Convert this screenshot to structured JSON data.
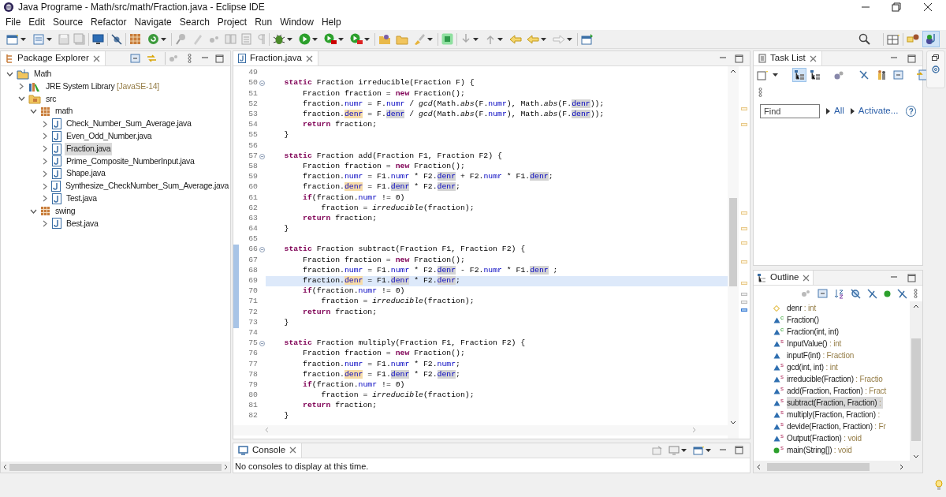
{
  "window": {
    "title": "Java Programe - Math/src/math/Fraction.java - Eclipse IDE"
  },
  "menu": [
    "File",
    "Edit",
    "Source",
    "Refactor",
    "Navigate",
    "Search",
    "Project",
    "Run",
    "Window",
    "Help"
  ],
  "package_explorer": {
    "title": "Package Explorer",
    "tree": [
      {
        "label": "Math",
        "kind": "project",
        "expanded": true,
        "selected": false,
        "children": [
          {
            "label": "JRE System Library",
            "suffix": "[JavaSE-14]",
            "kind": "library",
            "expanded": false,
            "selected": false
          },
          {
            "label": "src",
            "kind": "source-folder",
            "expanded": true,
            "selected": false,
            "children": [
              {
                "label": "math",
                "kind": "package",
                "expanded": true,
                "selected": false,
                "children": [
                  {
                    "label": "Check_Number_Sum_Average.java",
                    "kind": "java-file",
                    "expanded": false,
                    "selected": false
                  },
                  {
                    "label": "Even_Odd_Number.java",
                    "kind": "java-file",
                    "expanded": false,
                    "selected": false
                  },
                  {
                    "label": "Fraction.java",
                    "kind": "java-file",
                    "expanded": false,
                    "selected": true
                  },
                  {
                    "label": "Prime_Composite_NumberInput.java",
                    "kind": "java-file",
                    "expanded": false,
                    "selected": false
                  },
                  {
                    "label": "Shape.java",
                    "kind": "java-file",
                    "expanded": false,
                    "selected": false
                  },
                  {
                    "label": "Synthesize_CheckNumber_Sum_Average.java",
                    "kind": "java-file",
                    "expanded": false,
                    "selected": false
                  },
                  {
                    "label": "Test.java",
                    "kind": "java-file",
                    "expanded": false,
                    "selected": false
                  }
                ]
              },
              {
                "label": "swing",
                "kind": "package",
                "expanded": true,
                "selected": false,
                "children": [
                  {
                    "label": "Best.java",
                    "kind": "java-file",
                    "expanded": false,
                    "selected": false
                  }
                ]
              }
            ]
          }
        ]
      }
    ]
  },
  "editor": {
    "tab": "Fraction.java",
    "lines": [
      {
        "number": "49",
        "fold": false,
        "changed": false,
        "current": false
      },
      {
        "number": "50",
        "fold": true,
        "changed": false,
        "current": false,
        "tokens": [
          {
            "kind": "keyword",
            "text": "    static"
          },
          {
            "kind": "plain",
            "text": " Fraction irreducible(Fraction F) {"
          }
        ]
      },
      {
        "number": "51",
        "fold": false,
        "changed": false,
        "current": false,
        "tokens": [
          {
            "kind": "plain",
            "text": "        Fraction fraction = "
          },
          {
            "kind": "keyword",
            "text": "new"
          },
          {
            "kind": "plain",
            "text": " Fraction();"
          }
        ]
      },
      {
        "number": "52",
        "fold": false,
        "changed": false,
        "current": false,
        "tokens": [
          {
            "kind": "plain",
            "text": "        fraction."
          },
          {
            "kind": "field",
            "text": "numr"
          },
          {
            "kind": "plain",
            "text": " = F."
          },
          {
            "kind": "field",
            "text": "numr"
          },
          {
            "kind": "plain",
            "text": " / "
          },
          {
            "kind": "call",
            "text": "gcd"
          },
          {
            "kind": "plain",
            "text": "(Math."
          },
          {
            "kind": "call",
            "text": "abs"
          },
          {
            "kind": "plain",
            "text": "(F."
          },
          {
            "kind": "field",
            "text": "numr"
          },
          {
            "kind": "plain",
            "text": "), Math."
          },
          {
            "kind": "call",
            "text": "abs"
          },
          {
            "kind": "plain",
            "text": "(F."
          },
          {
            "kind": "field-read",
            "text": "denr"
          },
          {
            "kind": "plain",
            "text": "));"
          }
        ]
      },
      {
        "number": "53",
        "fold": false,
        "changed": false,
        "current": false,
        "tokens": [
          {
            "kind": "plain",
            "text": "        fraction."
          },
          {
            "kind": "field-write",
            "text": "denr"
          },
          {
            "kind": "plain",
            "text": " = F."
          },
          {
            "kind": "field-read",
            "text": "denr"
          },
          {
            "kind": "plain",
            "text": " / "
          },
          {
            "kind": "call",
            "text": "gcd"
          },
          {
            "kind": "plain",
            "text": "(Math."
          },
          {
            "kind": "call",
            "text": "abs"
          },
          {
            "kind": "plain",
            "text": "(F."
          },
          {
            "kind": "field",
            "text": "numr"
          },
          {
            "kind": "plain",
            "text": "), Math."
          },
          {
            "kind": "call",
            "text": "abs"
          },
          {
            "kind": "plain",
            "text": "(F."
          },
          {
            "kind": "field-read",
            "text": "denr"
          },
          {
            "kind": "plain",
            "text": "));"
          }
        ]
      },
      {
        "number": "54",
        "fold": false,
        "changed": false,
        "current": false,
        "tokens": [
          {
            "kind": "keyword",
            "text": "        return"
          },
          {
            "kind": "plain",
            "text": " fraction;"
          }
        ]
      },
      {
        "number": "55",
        "fold": false,
        "changed": false,
        "current": false,
        "tokens": [
          {
            "kind": "plain",
            "text": "    }"
          }
        ]
      },
      {
        "number": "56",
        "fold": false,
        "changed": false,
        "current": false
      },
      {
        "number": "57",
        "fold": true,
        "changed": false,
        "current": false,
        "tokens": [
          {
            "kind": "keyword",
            "text": "    static"
          },
          {
            "kind": "plain",
            "text": " Fraction add(Fraction F1, Fraction F2) {"
          }
        ]
      },
      {
        "number": "58",
        "fold": false,
        "changed": false,
        "current": false,
        "tokens": [
          {
            "kind": "plain",
            "text": "        Fraction fraction = "
          },
          {
            "kind": "keyword",
            "text": "new"
          },
          {
            "kind": "plain",
            "text": " Fraction();"
          }
        ]
      },
      {
        "number": "59",
        "fold": false,
        "changed": false,
        "current": false,
        "tokens": [
          {
            "kind": "plain",
            "text": "        fraction."
          },
          {
            "kind": "field",
            "text": "numr"
          },
          {
            "kind": "plain",
            "text": " = F1."
          },
          {
            "kind": "field",
            "text": "numr"
          },
          {
            "kind": "plain",
            "text": " * F2."
          },
          {
            "kind": "field-read",
            "text": "denr"
          },
          {
            "kind": "plain",
            "text": " + F2."
          },
          {
            "kind": "field",
            "text": "numr"
          },
          {
            "kind": "plain",
            "text": " * F1."
          },
          {
            "kind": "field-read",
            "text": "denr"
          },
          {
            "kind": "plain",
            "text": ";"
          }
        ]
      },
      {
        "number": "60",
        "fold": false,
        "changed": false,
        "current": false,
        "tokens": [
          {
            "kind": "plain",
            "text": "        fraction."
          },
          {
            "kind": "field-write",
            "text": "denr"
          },
          {
            "kind": "plain",
            "text": " = F1."
          },
          {
            "kind": "field-read",
            "text": "denr"
          },
          {
            "kind": "plain",
            "text": " * F2."
          },
          {
            "kind": "field-read",
            "text": "denr"
          },
          {
            "kind": "plain",
            "text": ";"
          }
        ]
      },
      {
        "number": "61",
        "fold": false,
        "changed": false,
        "current": false,
        "tokens": [
          {
            "kind": "keyword",
            "text": "        if"
          },
          {
            "kind": "plain",
            "text": "(fraction."
          },
          {
            "kind": "field",
            "text": "numr"
          },
          {
            "kind": "plain",
            "text": " != 0)"
          }
        ]
      },
      {
        "number": "62",
        "fold": false,
        "changed": false,
        "current": false,
        "tokens": [
          {
            "kind": "plain",
            "text": "            fraction = "
          },
          {
            "kind": "call",
            "text": "irreducible"
          },
          {
            "kind": "plain",
            "text": "(fraction);"
          }
        ]
      },
      {
        "number": "63",
        "fold": false,
        "changed": false,
        "current": false,
        "tokens": [
          {
            "kind": "keyword",
            "text": "        return"
          },
          {
            "kind": "plain",
            "text": " fraction;"
          }
        ]
      },
      {
        "number": "64",
        "fold": false,
        "changed": false,
        "current": false,
        "tokens": [
          {
            "kind": "plain",
            "text": "    }"
          }
        ]
      },
      {
        "number": "65",
        "fold": false,
        "changed": false,
        "current": false
      },
      {
        "number": "66",
        "fold": true,
        "changed": true,
        "current": false,
        "tokens": [
          {
            "kind": "keyword",
            "text": "    static"
          },
          {
            "kind": "plain",
            "text": " Fraction subtract(Fraction F1, Fraction F2) {"
          }
        ]
      },
      {
        "number": "67",
        "fold": false,
        "changed": true,
        "current": false,
        "tokens": [
          {
            "kind": "plain",
            "text": "        Fraction fraction = "
          },
          {
            "kind": "keyword",
            "text": "new"
          },
          {
            "kind": "plain",
            "text": " Fraction();"
          }
        ]
      },
      {
        "number": "68",
        "fold": false,
        "changed": true,
        "current": false,
        "tokens": [
          {
            "kind": "plain",
            "text": "        fraction."
          },
          {
            "kind": "field",
            "text": "numr"
          },
          {
            "kind": "plain",
            "text": " = F1."
          },
          {
            "kind": "field",
            "text": "numr"
          },
          {
            "kind": "plain",
            "text": " * F2."
          },
          {
            "kind": "field-read",
            "text": "denr"
          },
          {
            "kind": "plain",
            "text": " - F2."
          },
          {
            "kind": "field",
            "text": "numr"
          },
          {
            "kind": "plain",
            "text": " * F1."
          },
          {
            "kind": "field-read",
            "text": "denr"
          },
          {
            "kind": "plain",
            "text": " ;"
          }
        ]
      },
      {
        "number": "69",
        "fold": false,
        "changed": true,
        "current": true,
        "tokens": [
          {
            "kind": "plain",
            "text": "        fraction."
          },
          {
            "kind": "field-write",
            "text": "denr"
          },
          {
            "kind": "plain",
            "text": " = F1."
          },
          {
            "kind": "field-read",
            "text": "denr"
          },
          {
            "kind": "plain",
            "text": " * F2."
          },
          {
            "kind": "field-read",
            "text": "denr"
          },
          {
            "kind": "plain",
            "text": ";"
          }
        ]
      },
      {
        "number": "70",
        "fold": false,
        "changed": true,
        "current": false,
        "tokens": [
          {
            "kind": "keyword",
            "text": "        if"
          },
          {
            "kind": "plain",
            "text": "(fraction."
          },
          {
            "kind": "field",
            "text": "numr"
          },
          {
            "kind": "plain",
            "text": " != 0)"
          }
        ]
      },
      {
        "number": "71",
        "fold": false,
        "changed": true,
        "current": false,
        "tokens": [
          {
            "kind": "plain",
            "text": "            fraction = "
          },
          {
            "kind": "call",
            "text": "irreducible"
          },
          {
            "kind": "plain",
            "text": "(fraction);"
          }
        ]
      },
      {
        "number": "72",
        "fold": false,
        "changed": true,
        "current": false,
        "tokens": [
          {
            "kind": "keyword",
            "text": "        return"
          },
          {
            "kind": "plain",
            "text": " fraction;"
          }
        ]
      },
      {
        "number": "73",
        "fold": false,
        "changed": true,
        "current": false,
        "tokens": [
          {
            "kind": "plain",
            "text": "    }"
          }
        ]
      },
      {
        "number": "74",
        "fold": false,
        "changed": false,
        "current": false
      },
      {
        "number": "75",
        "fold": true,
        "changed": false,
        "current": false,
        "tokens": [
          {
            "kind": "keyword",
            "text": "    static"
          },
          {
            "kind": "plain",
            "text": " Fraction multiply(Fraction F1, Fraction F2) {"
          }
        ]
      },
      {
        "number": "76",
        "fold": false,
        "changed": false,
        "current": false,
        "tokens": [
          {
            "kind": "plain",
            "text": "        Fraction fraction = "
          },
          {
            "kind": "keyword",
            "text": "new"
          },
          {
            "kind": "plain",
            "text": " Fraction();"
          }
        ]
      },
      {
        "number": "77",
        "fold": false,
        "changed": false,
        "current": false,
        "tokens": [
          {
            "kind": "plain",
            "text": "        fraction."
          },
          {
            "kind": "field",
            "text": "numr"
          },
          {
            "kind": "plain",
            "text": " = F1."
          },
          {
            "kind": "field",
            "text": "numr"
          },
          {
            "kind": "plain",
            "text": " * F2."
          },
          {
            "kind": "field",
            "text": "numr"
          },
          {
            "kind": "plain",
            "text": ";"
          }
        ]
      },
      {
        "number": "78",
        "fold": false,
        "changed": false,
        "current": false,
        "tokens": [
          {
            "kind": "plain",
            "text": "        fraction."
          },
          {
            "kind": "field-write",
            "text": "denr"
          },
          {
            "kind": "plain",
            "text": " = F1."
          },
          {
            "kind": "field-read",
            "text": "denr"
          },
          {
            "kind": "plain",
            "text": " * F2."
          },
          {
            "kind": "field-read",
            "text": "denr"
          },
          {
            "kind": "plain",
            "text": ";"
          }
        ]
      },
      {
        "number": "79",
        "fold": false,
        "changed": false,
        "current": false,
        "tokens": [
          {
            "kind": "keyword",
            "text": "        if"
          },
          {
            "kind": "plain",
            "text": "(fraction."
          },
          {
            "kind": "field",
            "text": "numr"
          },
          {
            "kind": "plain",
            "text": " != 0)"
          }
        ]
      },
      {
        "number": "80",
        "fold": false,
        "changed": false,
        "current": false,
        "tokens": [
          {
            "kind": "plain",
            "text": "            fraction = "
          },
          {
            "kind": "call",
            "text": "irreducible"
          },
          {
            "kind": "plain",
            "text": "(fraction);"
          }
        ]
      },
      {
        "number": "81",
        "fold": false,
        "changed": false,
        "current": false,
        "tokens": [
          {
            "kind": "keyword",
            "text": "        return"
          },
          {
            "kind": "plain",
            "text": " fraction;"
          }
        ]
      },
      {
        "number": "82",
        "fold": false,
        "changed": false,
        "current": false,
        "tokens": [
          {
            "kind": "plain",
            "text": "    }"
          }
        ]
      }
    ]
  },
  "console": {
    "title": "Console",
    "message": "No consoles to display at this time."
  },
  "task_list": {
    "title": "Task List",
    "find_placeholder": "Find",
    "filters": [
      "All",
      "Activate..."
    ],
    "help": "?"
  },
  "outline": {
    "title": "Outline",
    "items": [
      {
        "kind": "field",
        "name": "denr",
        "type": ": int",
        "selected": false
      },
      {
        "kind": "method",
        "modifier": "c",
        "name": "Fraction()",
        "selected": false
      },
      {
        "kind": "method",
        "modifier": "c",
        "name": "Fraction(int, int)",
        "selected": false
      },
      {
        "kind": "method",
        "modifier": "s",
        "name": "InputValue()",
        "type": ": int",
        "selected": false
      },
      {
        "kind": "method",
        "name": "inputF(int)",
        "type": ": Fraction",
        "selected": false
      },
      {
        "kind": "method",
        "modifier": "s",
        "name": "gcd(int, int)",
        "type": ": int",
        "selected": false
      },
      {
        "kind": "method",
        "modifier": "s",
        "name": "irreducible(Fraction)",
        "type": ": Fractio",
        "selected": false
      },
      {
        "kind": "method",
        "modifier": "s",
        "name": "add(Fraction, Fraction)",
        "type": ": Fract",
        "selected": false
      },
      {
        "kind": "method",
        "modifier": "s",
        "name": "subtract(Fraction, Fraction)",
        "type": ":",
        "selected": true
      },
      {
        "kind": "method",
        "modifier": "s",
        "name": "multiply(Fraction, Fraction)",
        "type": ":",
        "selected": false
      },
      {
        "kind": "method",
        "modifier": "s",
        "name": "devide(Fraction, Fraction)",
        "type": ": Fr",
        "selected": false
      },
      {
        "kind": "method",
        "modifier": "s",
        "name": "Output(Fraction)",
        "type": ": void",
        "selected": false
      },
      {
        "kind": "main",
        "modifier": "s",
        "name": "main(String[])",
        "type": ": void",
        "selected": false
      }
    ]
  }
}
